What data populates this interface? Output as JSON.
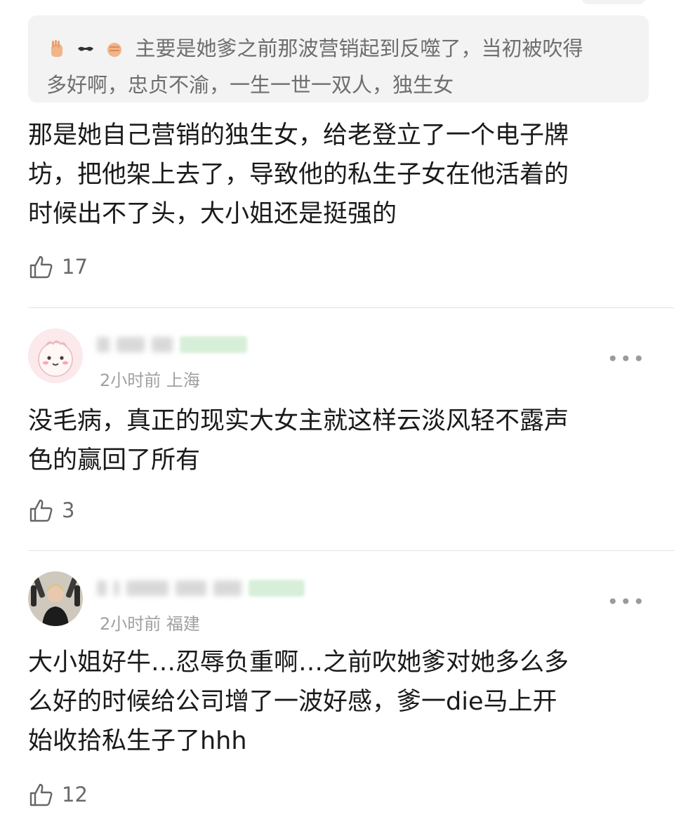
{
  "quote": {
    "line1": "主要是她爹之前那波营销起到反噬了，当初被吹得",
    "line2": "多好啊，忠贞不渝，一生一世一双人，独生女",
    "emoji_icons": [
      "raised-hand-icon",
      "sunglasses-icon",
      "fist-icon"
    ]
  },
  "comments": [
    {
      "lines": [
        "那是她自己营销的独生女，给老登立了一个电子牌",
        "坊，把他架上去了，导致他的私生子女在他活着的",
        "时候出不了头，大小姐还是挺强的"
      ],
      "likes": "17"
    },
    {
      "meta": "2小时前 上海",
      "more": "•••",
      "avatar_icon": "cartoon-avatar-icon",
      "lines": [
        "没毛病，真正的现实大女主就这样云淡风轻不露声",
        "色的赢回了所有"
      ],
      "likes": "3"
    },
    {
      "meta": "2小时前 福建",
      "more": "•••",
      "avatar_icon": "photo-avatar-icon",
      "lines": [
        "大小姐好牛…忍辱负重啊…之前吹她爹对她多么多",
        "么好的时候给公司增了一波好感，爹一die马上开",
        "始收拾私生子了hhh"
      ],
      "likes": "12"
    }
  ],
  "colors": {
    "quote_bg": "#f3f3f3",
    "quote_text": "#6e6e6e",
    "meta_text": "#a0a0a0",
    "badge": "#d7efd9"
  }
}
